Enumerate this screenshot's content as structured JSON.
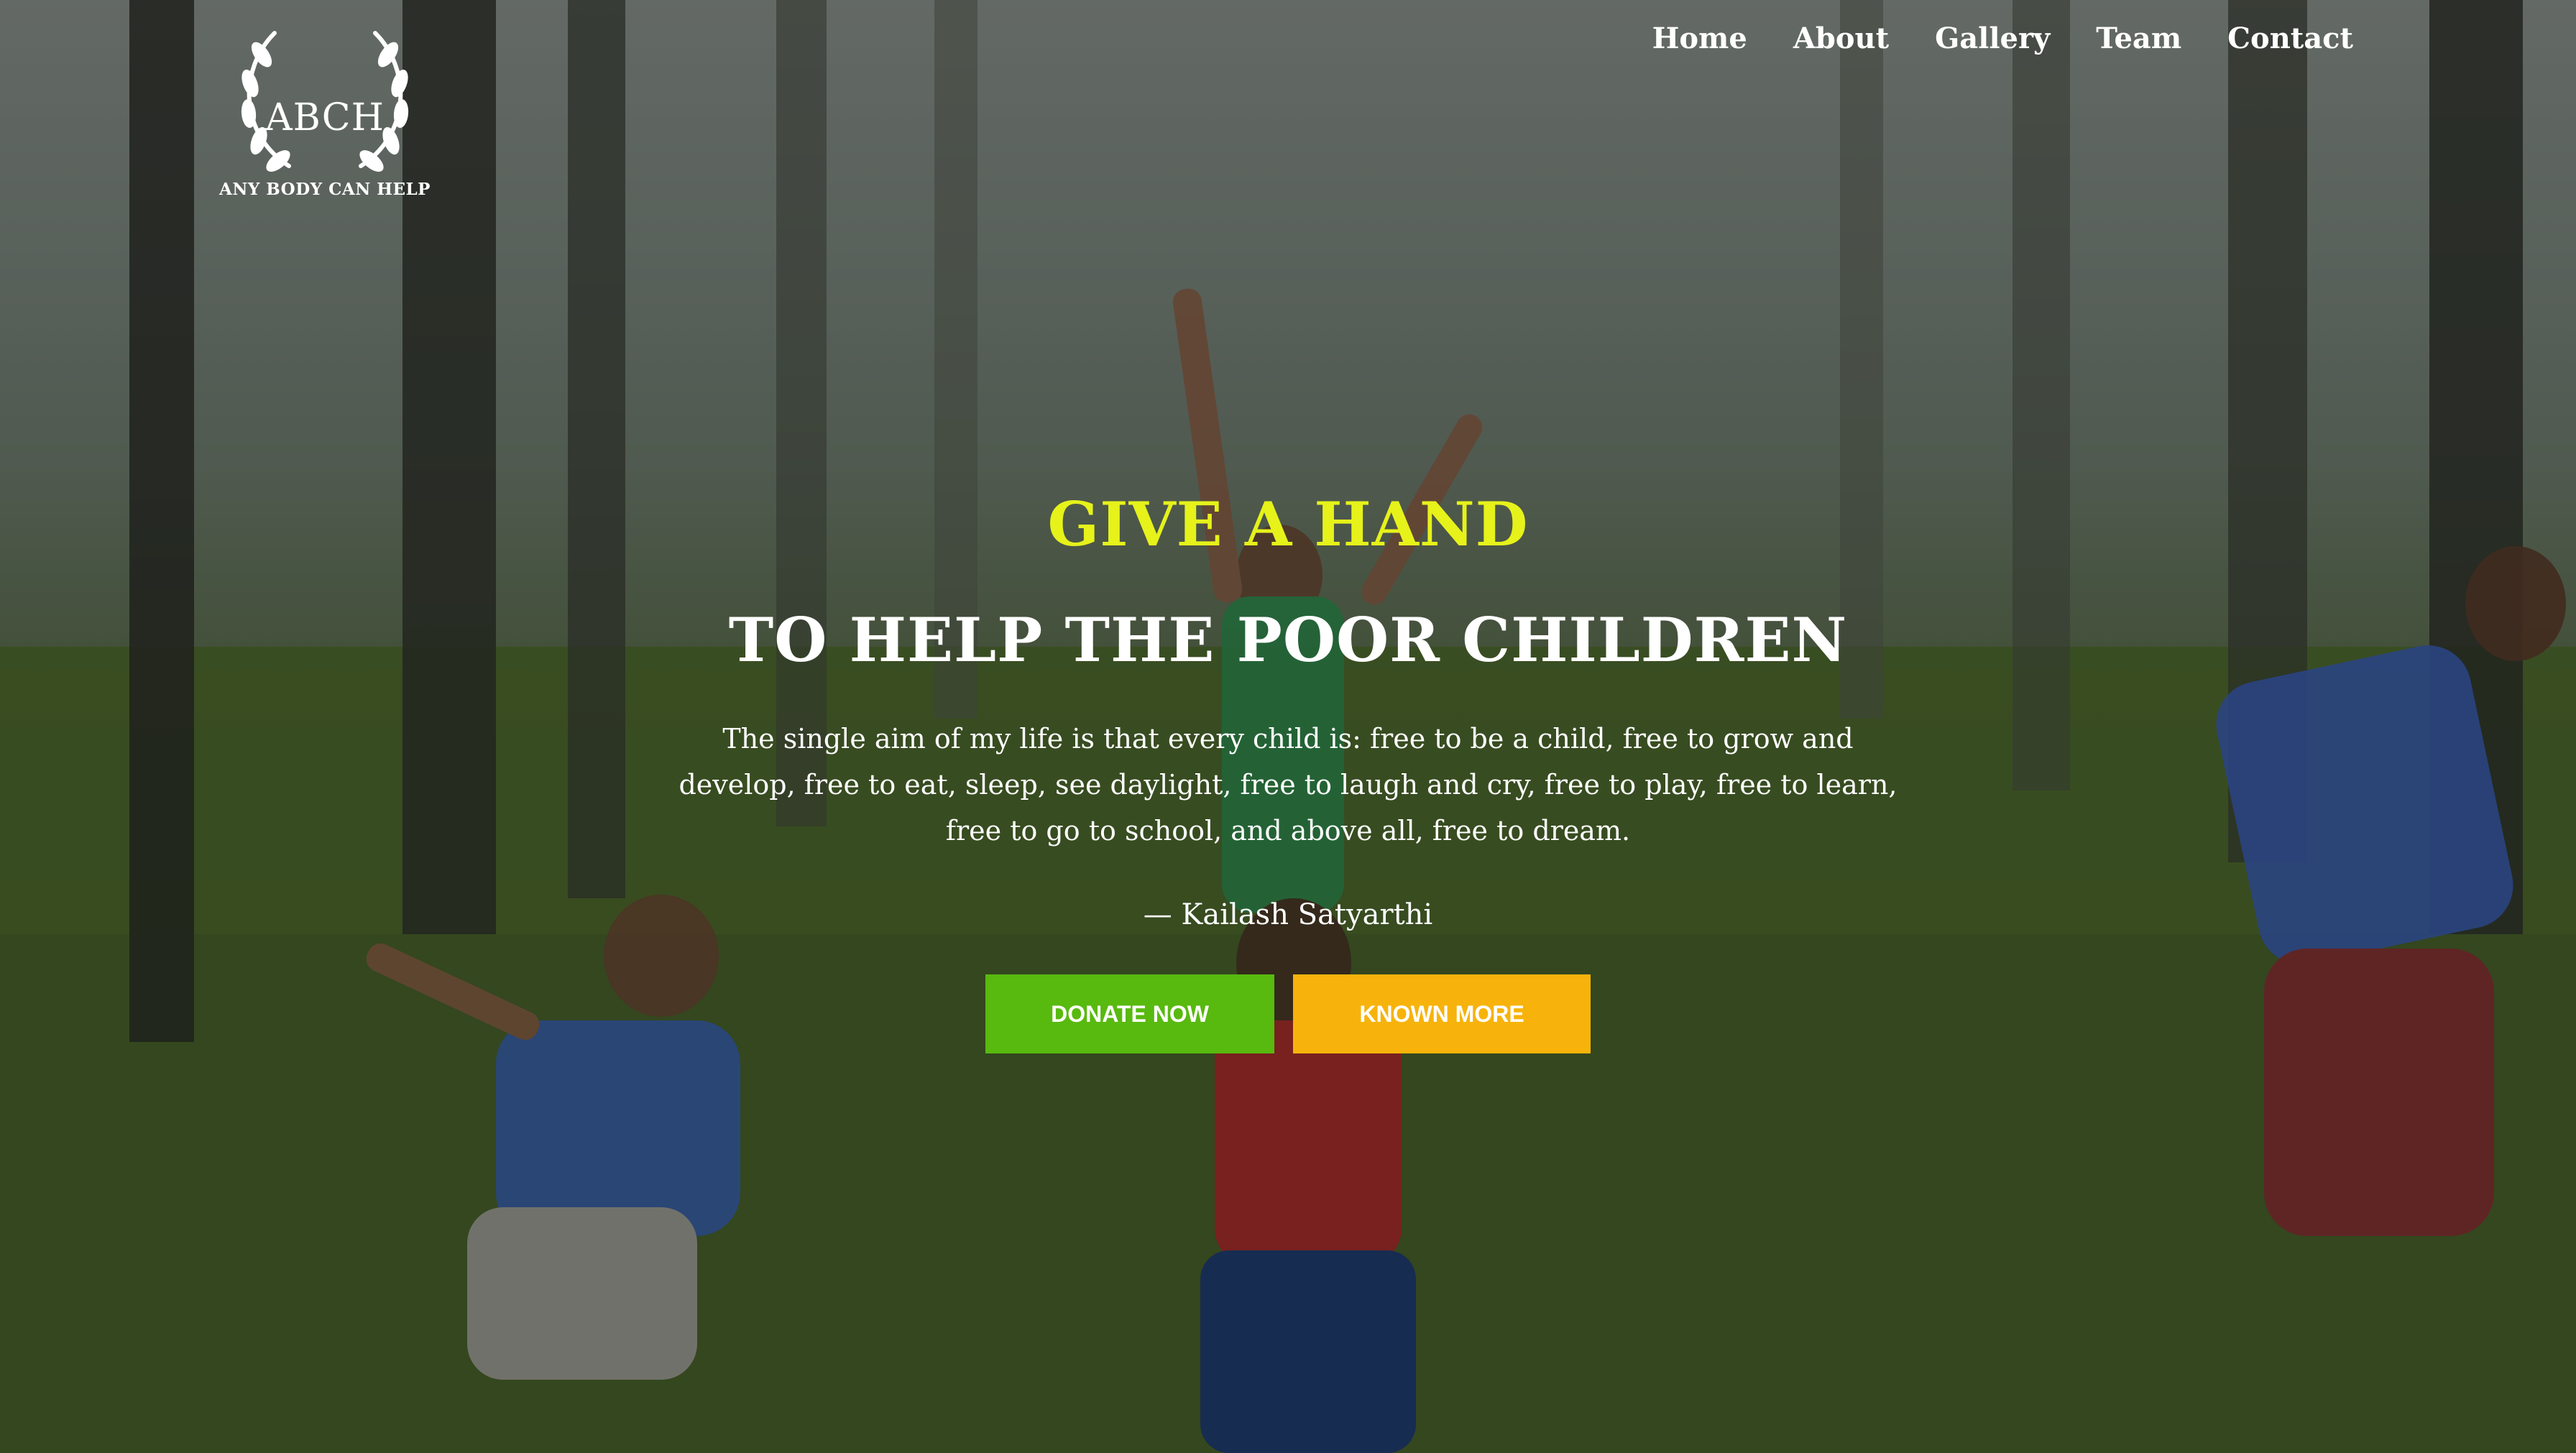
{
  "brand": {
    "mark": "ABCH",
    "tagline": "ANY BODY CAN HELP",
    "icon": "laurel-wreath-icon"
  },
  "nav": {
    "items": [
      {
        "label": "Home"
      },
      {
        "label": "About"
      },
      {
        "label": "Gallery"
      },
      {
        "label": "Team"
      },
      {
        "label": "Contact"
      }
    ]
  },
  "hero": {
    "kicker": "GIVE A HAND",
    "headline": "TO HELP THE POOR CHILDREN",
    "quote": "The single aim of my life is that every child is: free to be a child, free to grow and develop, free to eat, sleep, see daylight, free to laugh and cry, free to play, free to learn, free to go to school, and above all, free to dream.",
    "author": "— Kailash Satyarthi",
    "background": "children-playing-in-forest-image"
  },
  "buttons": {
    "donate": "DONATE NOW",
    "know": "KNOWN MORE"
  },
  "colors": {
    "kicker": "#e6f21a",
    "donate": "#58b90f",
    "know": "#f7b30b"
  }
}
